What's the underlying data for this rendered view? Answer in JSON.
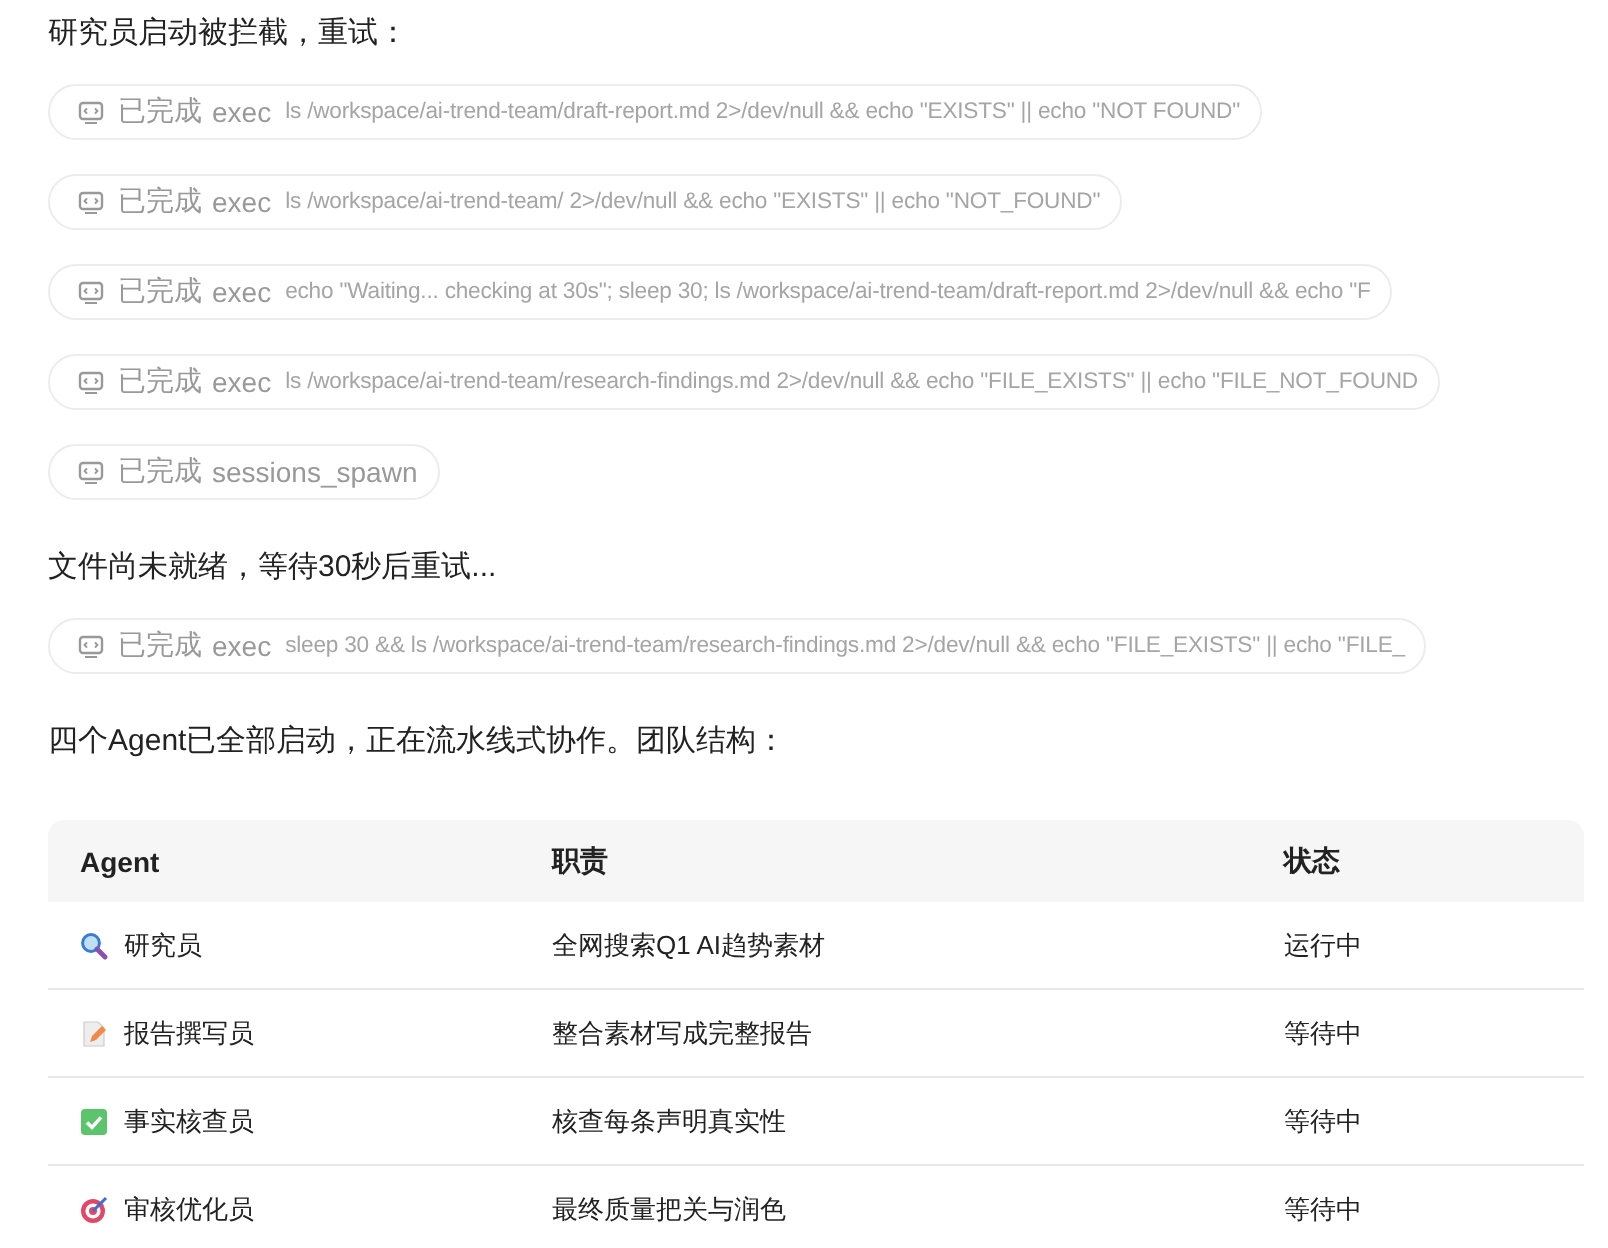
{
  "blocks": [
    {
      "kind": "text",
      "text": "研究员启动被拦截，重试："
    },
    {
      "kind": "tool",
      "status": "已完成",
      "tool": "exec",
      "command": "ls /workspace/ai-trend-team/draft-report.md 2>/dev/null && echo \"EXISTS\" || echo \"NOT FOUND\""
    },
    {
      "kind": "tool",
      "status": "已完成",
      "tool": "exec",
      "command": "ls /workspace/ai-trend-team/ 2>/dev/null && echo \"EXISTS\" || echo \"NOT_FOUND\""
    },
    {
      "kind": "tool",
      "status": "已完成",
      "tool": "exec",
      "command": "echo \"Waiting... checking at 30s\"; sleep 30; ls /workspace/ai-trend-team/draft-report.md 2>/dev/null && echo \"F"
    },
    {
      "kind": "tool",
      "status": "已完成",
      "tool": "exec",
      "command": "ls /workspace/ai-trend-team/research-findings.md 2>/dev/null && echo \"FILE_EXISTS\" || echo \"FILE_NOT_FOUND"
    },
    {
      "kind": "tool",
      "status": "已完成",
      "tool": "sessions_spawn"
    },
    {
      "kind": "text",
      "text": "文件尚未就绪，等待30秒后重试..."
    },
    {
      "kind": "tool",
      "status": "已完成",
      "tool": "exec",
      "command": "sleep 30 && ls /workspace/ai-trend-team/research-findings.md 2>/dev/null && echo \"FILE_EXISTS\" || echo \"FILE_"
    },
    {
      "kind": "text",
      "text": "四个Agent已全部启动，正在流水线式协作。团队结构："
    }
  ],
  "table": {
    "columns": [
      "Agent",
      "职责",
      "状态"
    ],
    "rows": [
      {
        "kind": "magnifier",
        "agent": "研究员",
        "duty": "全网搜索Q1 AI趋势素材",
        "status": "运行中"
      },
      {
        "kind": "document",
        "agent": "报告撰写员",
        "duty": "整合素材写成完整报告",
        "status": "等待中"
      },
      {
        "kind": "check",
        "agent": "事实核查员",
        "duty": "核查每条声明真实性",
        "status": "等待中"
      },
      {
        "kind": "target",
        "agent": "审核优化员",
        "duty": "最终质量把关与润色",
        "status": "等待中"
      }
    ]
  }
}
